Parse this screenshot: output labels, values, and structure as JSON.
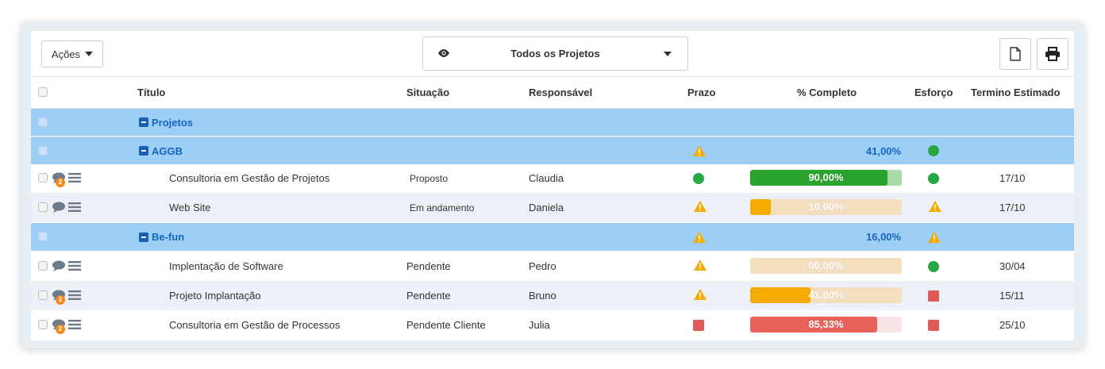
{
  "toolbar": {
    "actions_label": "Ações",
    "filter_label": "Todos os Projetos"
  },
  "columns": {
    "title": "Título",
    "status": "Situação",
    "owner": "Responsável",
    "deadline": "Prazo",
    "complete": "% Completo",
    "effort": "Esforço",
    "estimated_end": "Termino Estimado"
  },
  "groups": {
    "root": {
      "name": "Projetos"
    },
    "aggb": {
      "name": "AGGB",
      "complete": "41,00%"
    },
    "befun": {
      "name": "Be-fun",
      "complete": "16,00%"
    }
  },
  "tasks": [
    {
      "title": "Consultoria em Gestão de Projetos",
      "status": "Proposto",
      "owner": "Claudia",
      "complete": "90,00%",
      "complete_fraction": 0.9,
      "bar_color": "#2aa32f",
      "track_color": "#a8dba8",
      "end": "17/10",
      "comments": "2",
      "deadline_icon": "green-dot",
      "effort_icon": "green-dot"
    },
    {
      "title": "Web Site",
      "status": "Em andamento",
      "owner": "Daniela",
      "complete": "10,00%",
      "complete_fraction": 0.1,
      "bar_color": "#f5ab00",
      "track_color": "#f3dfbe",
      "end": "17/10",
      "comments": "",
      "deadline_icon": "warning-triangle",
      "effort_icon": "warning-triangle"
    },
    {
      "title": "Implentação de Software",
      "status": "Pendente",
      "owner": "Pedro",
      "complete": "00,00%",
      "complete_fraction": 0.0,
      "bar_color": "#f5ab00",
      "track_color": "#f3dfbe",
      "end": "30/04",
      "comments": "",
      "deadline_icon": "warning-triangle",
      "effort_icon": "green-dot"
    },
    {
      "title": "Projeto Implantação",
      "status": "Pendente",
      "owner": "Bruno",
      "complete": "41,00%",
      "complete_fraction": 0.41,
      "bar_color": "#f5ab00",
      "track_color": "#f3dfbe",
      "end": "15/11",
      "comments": "2",
      "deadline_icon": "warning-triangle",
      "effort_icon": "red-square"
    },
    {
      "title": "Consultoria em Gestão de Processos",
      "status": "Pendente Cliente",
      "owner": "Julia",
      "complete": "85,33%",
      "complete_fraction": 0.8533,
      "bar_color": "#e8625a",
      "track_color": "#f8e6e6",
      "end": "25/10",
      "comments": "2",
      "deadline_icon": "red-square",
      "effort_icon": "red-square"
    }
  ],
  "colors": {
    "group_bg": "#9dcef6",
    "group_text": "#1565c0",
    "warning": "#f5ab00",
    "ok": "#28a745",
    "alert": "#e05a5a"
  }
}
